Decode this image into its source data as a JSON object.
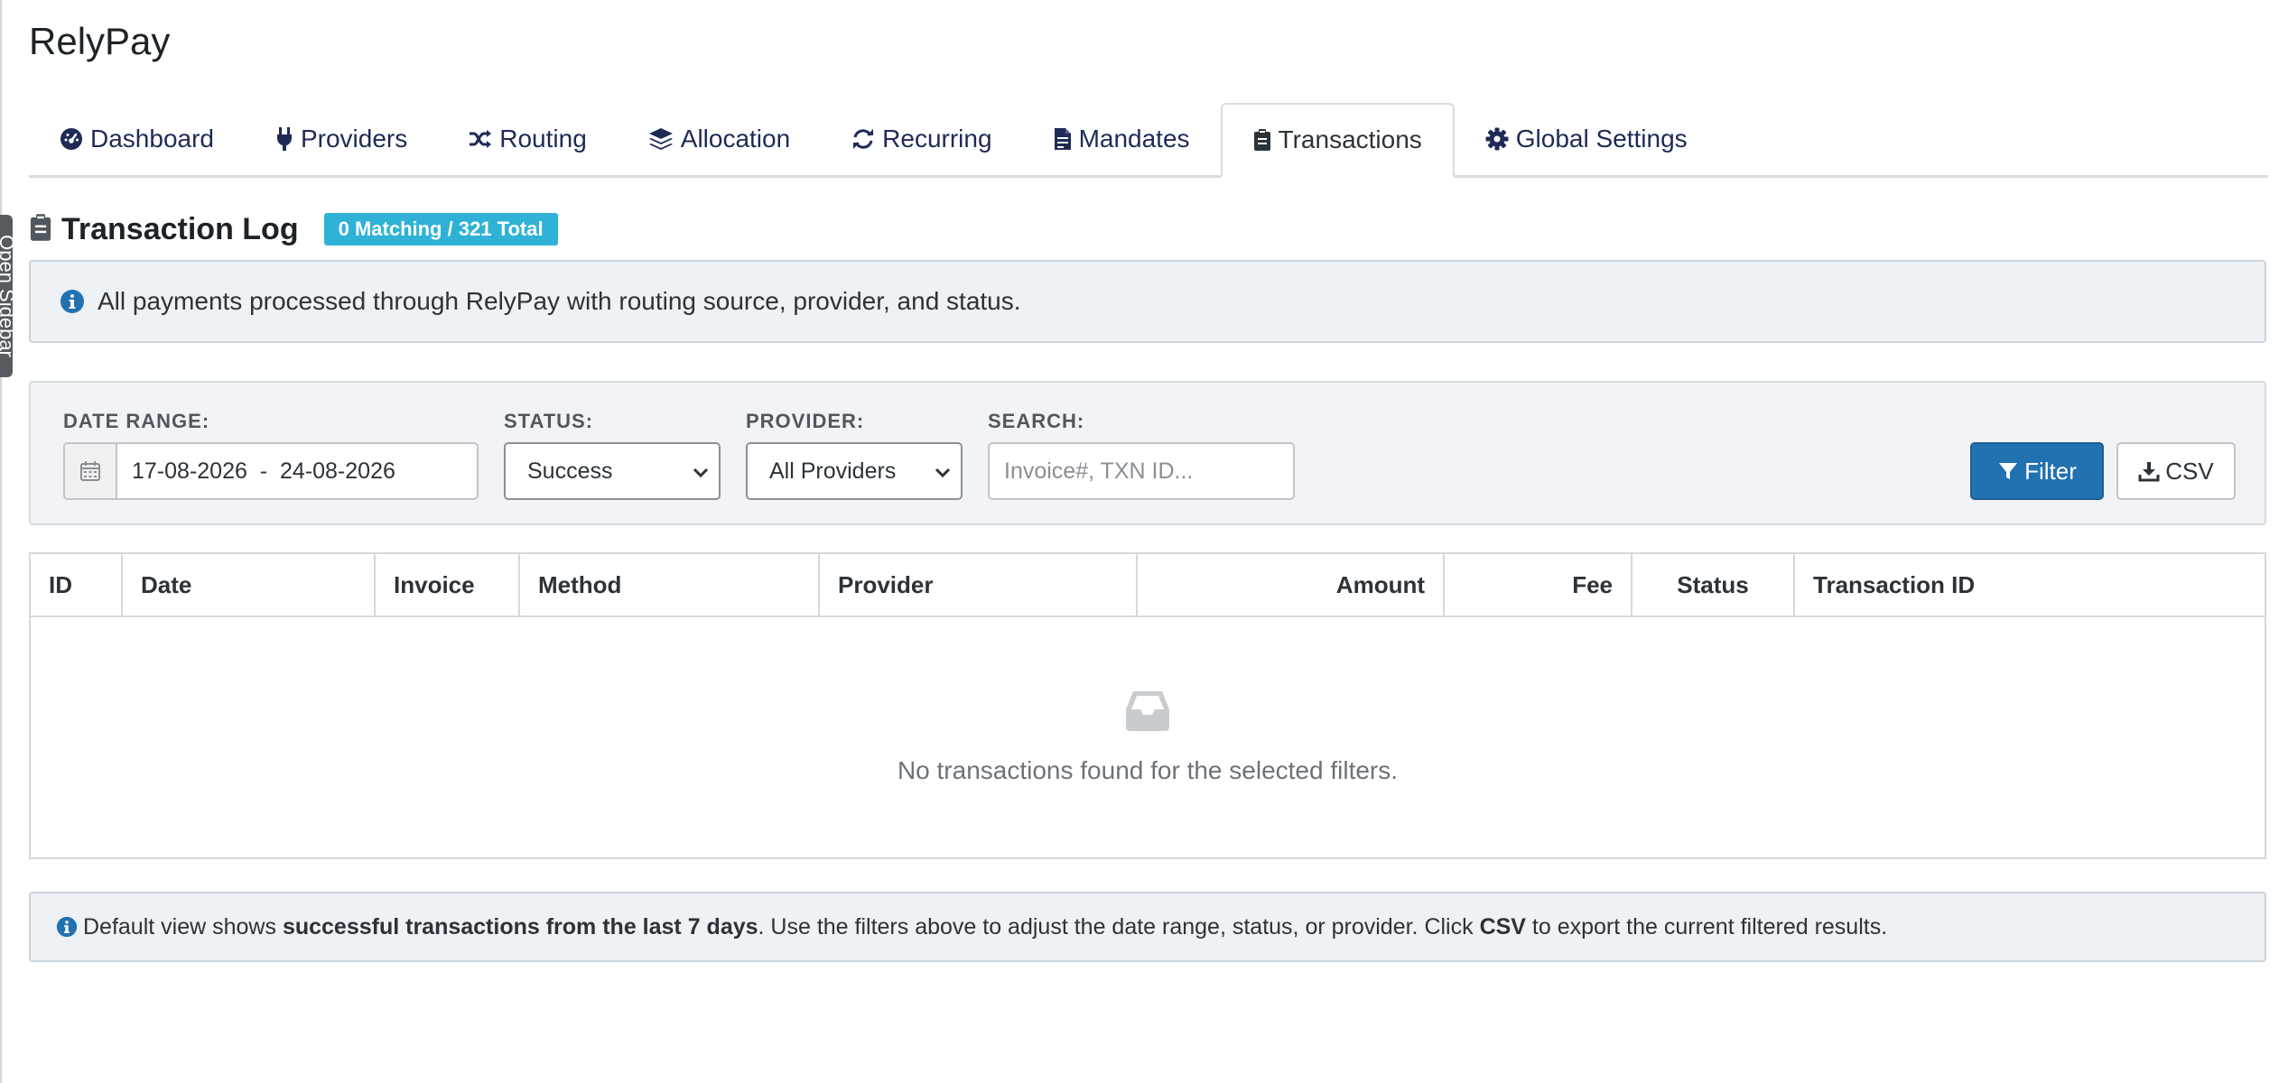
{
  "app": {
    "title": "RelyPay",
    "sidebar_toggle": "Open Sidebar"
  },
  "tabs": [
    {
      "label": "Dashboard",
      "icon": "gauge-icon",
      "active": false
    },
    {
      "label": "Providers",
      "icon": "plug-icon",
      "active": false
    },
    {
      "label": "Routing",
      "icon": "shuffle-icon",
      "active": false
    },
    {
      "label": "Allocation",
      "icon": "layers-icon",
      "active": false
    },
    {
      "label": "Recurring",
      "icon": "refresh-icon",
      "active": false
    },
    {
      "label": "Mandates",
      "icon": "file-contract-icon",
      "active": false
    },
    {
      "label": "Transactions",
      "icon": "clipboard-icon",
      "active": true
    },
    {
      "label": "Global Settings",
      "icon": "gear-icon",
      "active": false
    }
  ],
  "page": {
    "title": "Transaction Log",
    "badge": "0 Matching / 321 Total",
    "info": "All payments processed through RelyPay with routing source, provider, and status."
  },
  "filters": {
    "date_range_label": "DATE RANGE:",
    "date_range_value": "17-08-2026  -  24-08-2026",
    "status_label": "STATUS:",
    "status_value": "Success",
    "provider_label": "PROVIDER:",
    "provider_value": "All Providers",
    "search_label": "SEARCH:",
    "search_placeholder": "Invoice#, TXN ID...",
    "search_value": "",
    "filter_button": "Filter",
    "csv_button": "CSV"
  },
  "table": {
    "columns": [
      "ID",
      "Date",
      "Invoice",
      "Method",
      "Provider",
      "Amount",
      "Fee",
      "Status",
      "Transaction ID"
    ],
    "rows": [],
    "empty_message": "No transactions found for the selected filters."
  },
  "note": {
    "prefix": "Default view shows ",
    "bold1": "successful transactions from the last 7 days",
    "middle": ". Use the filters above to adjust the date range, status, or provider. Click ",
    "bold2": "CSV",
    "suffix": " to export the current filtered results."
  },
  "colors": {
    "nav_text": "#1f2a56",
    "badge": "#2fb2d6",
    "info_bg": "#eef1f5",
    "primary_button": "#2271b1"
  }
}
